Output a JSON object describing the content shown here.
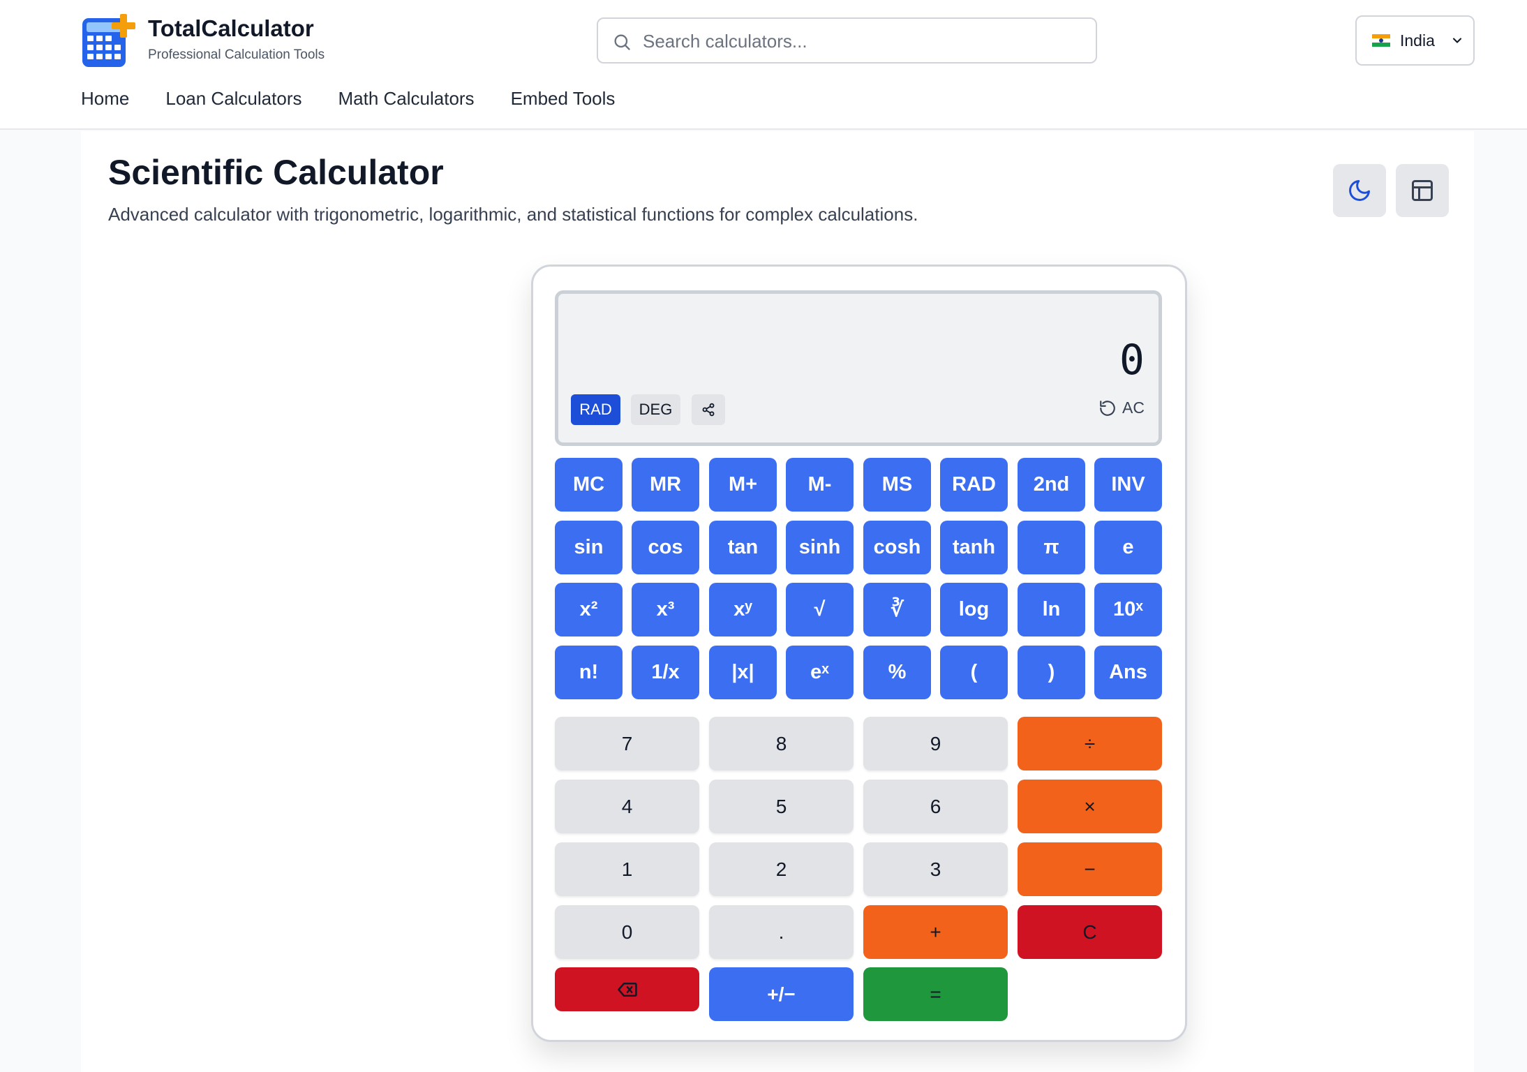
{
  "brand": {
    "name": "TotalCalculator",
    "tagline": "Professional Calculation Tools"
  },
  "search": {
    "placeholder": "Search calculators..."
  },
  "country": {
    "label": "India"
  },
  "nav": [
    "Home",
    "Loan Calculators",
    "Math Calculators",
    "Embed Tools"
  ],
  "page": {
    "title": "Scientific Calculator",
    "description": "Advanced calculator with trigonometric, logarithmic, and statistical functions for complex calculations."
  },
  "display": {
    "value": "0",
    "mode_rad": "RAD",
    "mode_deg": "DEG",
    "active_mode": "RAD",
    "ac_label": "AC"
  },
  "scientific_rows": [
    [
      "MC",
      "MR",
      "M+",
      "M-",
      "MS",
      "RAD",
      "2nd",
      "INV"
    ],
    [
      "sin",
      "cos",
      "tan",
      "sinh",
      "cosh",
      "tanh",
      "π",
      "e"
    ],
    [
      "x²",
      "x³",
      "xʸ",
      "√",
      "∛",
      "log",
      "ln",
      "10ˣ"
    ],
    [
      "n!",
      "1/x",
      "|x|",
      "eˣ",
      "%",
      "(",
      ")",
      "Ans"
    ]
  ],
  "keypad": {
    "row1": [
      "7",
      "8",
      "9",
      "÷"
    ],
    "row2": [
      "4",
      "5",
      "6",
      "×"
    ],
    "row3": [
      "1",
      "2",
      "3",
      "−"
    ],
    "row4": [
      "0",
      ".",
      "+",
      "C"
    ],
    "row5": [
      "",
      "+/−",
      "="
    ]
  },
  "colors": {
    "scientific": "#3b6ef0",
    "number": "#e2e3e6",
    "operator": "#f2621a",
    "danger": "#cf1322",
    "equals": "#1f973c",
    "active_mode": "#1d4ed8"
  }
}
